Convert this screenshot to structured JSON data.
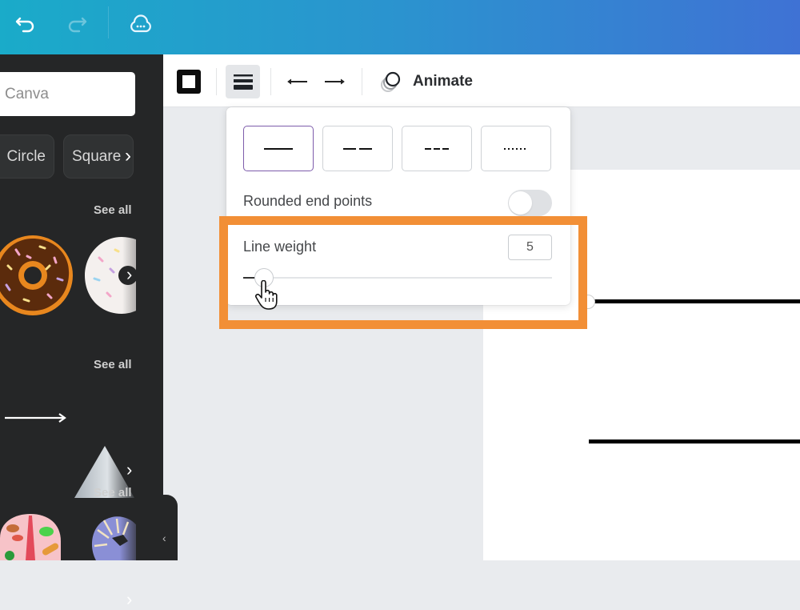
{
  "topbar": {
    "icons": [
      {
        "name": "undo-icon",
        "enabled": true
      },
      {
        "name": "redo-icon",
        "enabled": false
      },
      {
        "name": "cloud-sync-icon",
        "enabled": true
      }
    ]
  },
  "sidebar": {
    "search": {
      "value": "",
      "placeholder": "Canva"
    },
    "chips": [
      {
        "label": "Circle"
      },
      {
        "label": "Square"
      }
    ],
    "sections": [
      {
        "see_all": "See all",
        "items": [
          "chocolate-donut",
          "white-sprinkle-donut"
        ]
      },
      {
        "see_all": "See all",
        "items": [
          "arrow-line",
          "gray-cone-triangle"
        ]
      },
      {
        "see_all": "See all",
        "items": [
          "paris-sticker",
          "blue-striped-donut"
        ]
      }
    ]
  },
  "toolbar": {
    "items": [
      {
        "name": "border-style",
        "icon": "square-border-icon"
      },
      {
        "name": "line-style",
        "icon": "line-weight-icon",
        "active": true
      },
      {
        "name": "line-start",
        "icon": "arrow-left-icon"
      },
      {
        "name": "line-end",
        "icon": "arrow-right-icon"
      }
    ],
    "animate_label": "Animate"
  },
  "line_popover": {
    "styles": [
      {
        "name": "solid",
        "selected": true
      },
      {
        "name": "long-dash",
        "selected": false
      },
      {
        "name": "short-dash",
        "selected": false
      },
      {
        "name": "dotted",
        "selected": false
      }
    ],
    "rounded_label": "Rounded end points",
    "rounded_enabled": false,
    "weight_label": "Line weight",
    "weight_value": "5",
    "weight_min": 0,
    "weight_max": 100,
    "weight_fraction": 0.04
  },
  "annotation": {
    "color": "#f28f36"
  }
}
